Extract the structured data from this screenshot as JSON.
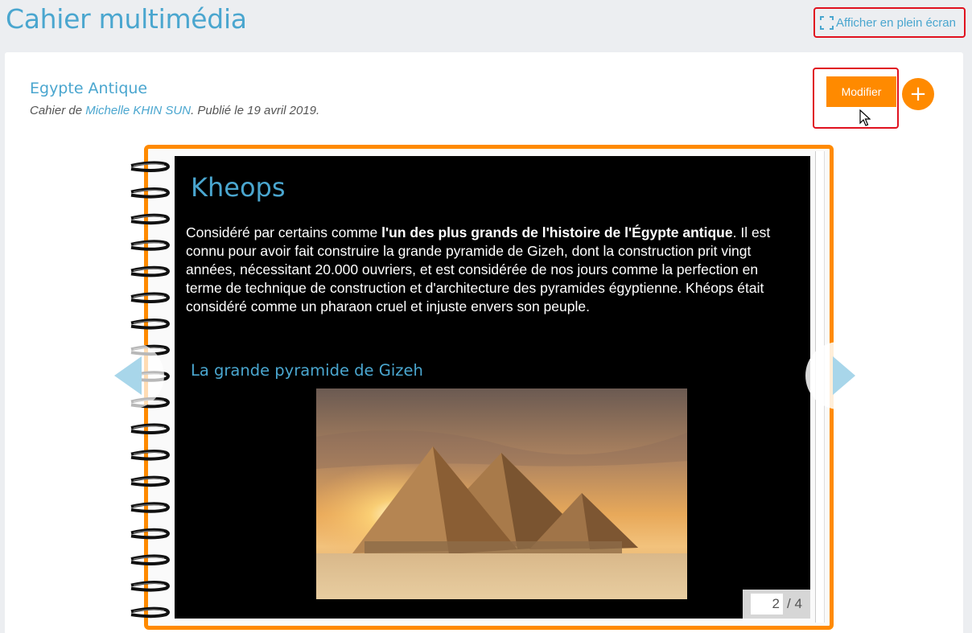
{
  "header": {
    "title": "Cahier multimédia",
    "fullscreen_label": "Afficher en plein écran"
  },
  "book": {
    "title": "Egypte Antique",
    "meta_prefix": "Cahier de ",
    "author": "Michelle KHIN SUN",
    "meta_suffix": ". Publié le 19 avril 2019."
  },
  "actions": {
    "modify_label": "Modifier",
    "add_label": "+"
  },
  "slide": {
    "title": "Kheops",
    "text_before": "Considéré par certains comme ",
    "text_bold": "l'un des plus grands de l'histoire de l'Égypte antique",
    "text_after": ". Il est connu pour avoir fait construire la grande pyramide de Gizeh, dont la construction prit vingt années, nécessitant 20.000 ouvriers, et est considérée de nos jours comme la perfection en terme de technique de construction et d'architecture des pyramides égyptienne. Khéops était considéré comme un pharaon cruel et injuste envers son peuple.",
    "subtitle": "La grande pyramide de Gizeh",
    "image_icon": "pyramids-photo"
  },
  "pager": {
    "current": "2",
    "total": "/ 4"
  },
  "colors": {
    "accent": "#4aa6cf",
    "orange": "#ff8a00",
    "highlight_red": "#e0121f"
  }
}
